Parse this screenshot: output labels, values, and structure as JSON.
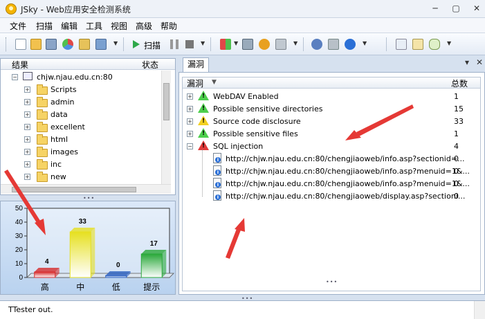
{
  "window": {
    "title": "JSky - Web应用安全检测系统",
    "minimize": "─",
    "maximize": "▢",
    "close": "✕"
  },
  "menu": [
    "文件",
    "扫描",
    "编辑",
    "工具",
    "视图",
    "高级",
    "帮助"
  ],
  "toolbar": {
    "scan_label": "扫描"
  },
  "left_panel": {
    "col_result": "结果",
    "col_status": "状态",
    "root": "chjw.njau.edu.cn:80",
    "folders": [
      "Scripts",
      "admin",
      "data",
      "excellent",
      "html",
      "images",
      "inc",
      "new"
    ]
  },
  "chart_data": {
    "type": "bar",
    "categories": [
      "高",
      "中",
      "低",
      "提示"
    ],
    "values": [
      4,
      33,
      0,
      17
    ],
    "colors": [
      "#d62b2b",
      "#e6e020",
      "#2a5fbf",
      "#2aa83a"
    ],
    "ylim": [
      0,
      50
    ],
    "yticks": [
      0,
      10,
      20,
      30,
      40,
      50
    ],
    "title": "",
    "xlabel": "",
    "ylabel": ""
  },
  "right_panel": {
    "tab_label": "漏洞",
    "col_vuln": "漏洞",
    "col_total": "总数",
    "pin": "▾",
    "close": "✕",
    "items": [
      {
        "label": "WebDAV Enabled",
        "count": "1",
        "level": "green"
      },
      {
        "label": "Possible sensitive directories",
        "count": "15",
        "level": "green"
      },
      {
        "label": "Source code disclosure",
        "count": "33",
        "level": "yellow"
      },
      {
        "label": "Possible sensitive files",
        "count": "1",
        "level": "green"
      },
      {
        "label": "SQL injection",
        "count": "4",
        "level": "red"
      }
    ],
    "sql_children": [
      {
        "url": "http://chjw.njau.edu.cn:80/chengjiaoweb/info.asp?sectionid=...",
        "count": "0"
      },
      {
        "url": "http://chjw.njau.edu.cn:80/chengjiaoweb/info.asp?menuid=1&...",
        "count": "0"
      },
      {
        "url": "http://chjw.njau.edu.cn:80/chengjiaoweb/info.asp?menuid=1&...",
        "count": "0"
      },
      {
        "url": "http://chjw.njau.edu.cn:80/chengjiaoweb/display.asp?sectioni...",
        "count": "0"
      }
    ]
  },
  "log": {
    "line1": "TTester out."
  }
}
